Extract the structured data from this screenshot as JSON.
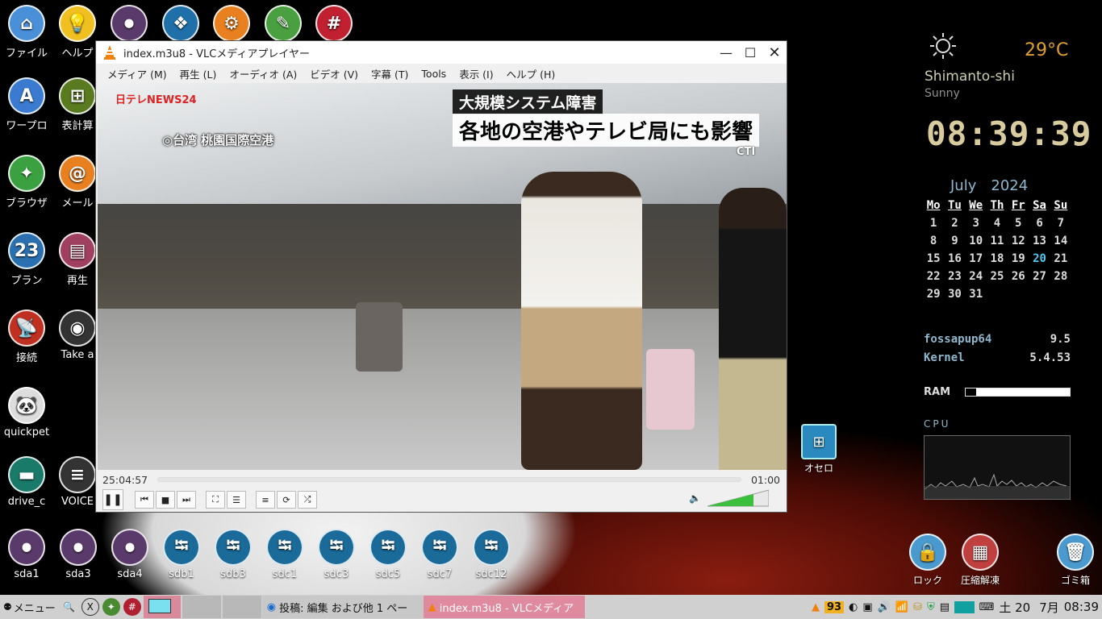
{
  "desktop_icons": [
    {
      "label": "ファイル",
      "icon": "home-folder-icon",
      "color": "#4a90d9",
      "glyph": "⌂"
    },
    {
      "label": "ヘルプ",
      "icon": "lightbulb-icon",
      "color": "#f0c020",
      "glyph": "💡"
    },
    {
      "label": "",
      "icon": "toggle-icon",
      "color": "#5a3a6a",
      "glyph": "⏺"
    },
    {
      "label": "",
      "icon": "dropbox-icon",
      "color": "#1f6fa8",
      "glyph": "❖"
    },
    {
      "label": "",
      "icon": "gear-icon",
      "color": "#e88020",
      "glyph": "⚙"
    },
    {
      "label": "",
      "icon": "notepad-icon",
      "color": "#4aa040",
      "glyph": "✎"
    },
    {
      "label": "",
      "icon": "hashtag-icon",
      "color": "#c02030",
      "glyph": "#"
    },
    {
      "label": "ワープロ",
      "icon": "wordprocessor-icon",
      "color": "#3a7ad0",
      "glyph": "A"
    },
    {
      "label": "表計算",
      "icon": "spreadsheet-icon",
      "color": "#5a7a20",
      "glyph": "⊞"
    },
    {
      "label": "ブラウザ",
      "icon": "compass-icon",
      "color": "#3aa040",
      "glyph": "✦"
    },
    {
      "label": "メール",
      "icon": "mail-icon",
      "color": "#e88020",
      "glyph": "@"
    },
    {
      "label": "プラン",
      "icon": "calendar-icon",
      "color": "#2a70b0",
      "glyph": "23"
    },
    {
      "label": "再生",
      "icon": "media-player-icon",
      "color": "#a04060",
      "glyph": "▤"
    },
    {
      "label": "接続",
      "icon": "satellite-icon",
      "color": "#c03020",
      "glyph": "📡"
    },
    {
      "label": "Take a",
      "icon": "camera-icon",
      "color": "#333333",
      "glyph": "◉"
    },
    {
      "label": "quickpet",
      "icon": "panda-icon",
      "color": "#dddddd",
      "glyph": "🐼"
    },
    {
      "label": "drive_c",
      "icon": "folder-icon",
      "color": "#1a7a6a",
      "glyph": "▬"
    },
    {
      "label": "VOICE",
      "icon": "voice-icon",
      "color": "#333333",
      "glyph": "≡"
    }
  ],
  "drives": [
    "sda1",
    "sda3",
    "sda4",
    "sdb1",
    "sdb3",
    "sdc1",
    "sdc3",
    "sdc5",
    "sdc7",
    "sdc12"
  ],
  "othello_label": "オセロ",
  "right_dock": [
    {
      "label": "ロック",
      "icon": "lock-icon",
      "color": "#4a9ad0"
    },
    {
      "label": "圧縮解凍",
      "icon": "archive-icon",
      "color": "#c04040"
    },
    {
      "label": "ゴミ箱",
      "icon": "trash-icon",
      "color": "#4a9ad0"
    }
  ],
  "vlc": {
    "title": "index.m3u8 - VLCメディアプレイヤー",
    "menus": [
      "メディア (M)",
      "再生 (L)",
      "オーディオ (A)",
      "ビデオ (V)",
      "字幕 (T)",
      "Tools",
      "表示 (I)",
      "ヘルプ (H)"
    ],
    "video": {
      "news_logo": "日テレNEWS24",
      "location": "◎台湾 桃園国際空港",
      "caption_top": "大規模システム障害",
      "caption_main": "各地の空港やテレビ局にも影響",
      "source": "CTI"
    },
    "time_elapsed": "25:04:57",
    "time_total": "01:00",
    "volume_percent": 75
  },
  "weather": {
    "temp": "29°C",
    "city": "Shimanto-shi",
    "condition": "Sunny"
  },
  "clock": "08:39:39",
  "calendar": {
    "month": "July",
    "year": "2024",
    "weekdays": [
      "Mo",
      "Tu",
      "We",
      "Th",
      "Fr",
      "Sa",
      "Su"
    ],
    "weeks": [
      [
        "",
        "1",
        "2",
        "3",
        "4",
        "5",
        "6",
        "7"
      ],
      [
        "",
        "8",
        "9",
        "10",
        "11",
        "12",
        "13",
        "14"
      ],
      [
        "",
        "15",
        "16",
        "17",
        "18",
        "19",
        "20",
        "21"
      ],
      [
        "",
        "22",
        "23",
        "24",
        "25",
        "26",
        "27",
        "28"
      ],
      [
        "",
        "29",
        "30",
        "31",
        "",
        "",
        "",
        ""
      ]
    ],
    "today": "20"
  },
  "system": {
    "os_name": "fossapup64",
    "os_version": "9.5",
    "kernel_label": "Kernel",
    "kernel_version": "5.4.53",
    "ram_label": "RAM",
    "ram_used_fraction": 0.1,
    "cpu_label": "CPU"
  },
  "taskbar": {
    "menu_label": "メニュー",
    "tasks": [
      "投稿: 編集 および他 1 ペー",
      "index.m3u8 - VLCメディア"
    ],
    "tray_badge": "93",
    "date": "土 20",
    "month": "7月",
    "time": "08:39"
  }
}
